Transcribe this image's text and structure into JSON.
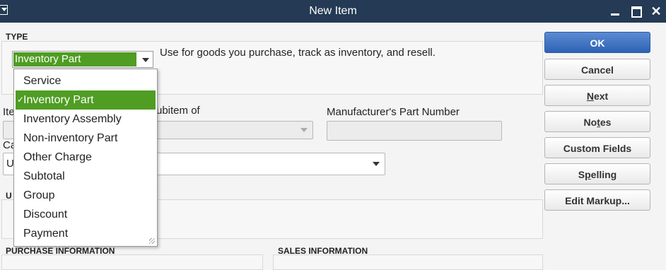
{
  "window": {
    "title": "New Item"
  },
  "type_section": {
    "header": "TYPE",
    "selected": "Inventory Part",
    "description": "Use for goods you purchase, track as inventory, and resell."
  },
  "dropdown": {
    "items": [
      "Service",
      "Inventory Part",
      "Inventory Assembly",
      "Non-inventory Part",
      "Other Charge",
      "Subtotal",
      "Group",
      "Discount",
      "Payment"
    ],
    "selected_index": 1
  },
  "form": {
    "item_label_partial": "Ite",
    "subitem_label": "ubitem of",
    "mpn_label": "Manufacturer's Part Number",
    "category_label_partial": "Ca",
    "category_value_partial": "U",
    "unit_label_partial": "U"
  },
  "buttons": {
    "ok": "OK",
    "cancel": "Cancel",
    "next_first": "N",
    "next_rest": "ext",
    "notes_pre": "No",
    "notes_u": "t",
    "notes_post": "es",
    "custom_fields": "Custom Fields",
    "spelling_pre": "S",
    "spelling_u": "p",
    "spelling_post": "elling",
    "edit_markup": "Edit Markup..."
  },
  "sections": {
    "purchase": "PURCHASE INFORMATION",
    "sales": "SALES INFORMATION"
  },
  "colors": {
    "titlebar": "#243a55",
    "selection": "#4f9d23",
    "ok_button": "#2d62b4"
  }
}
